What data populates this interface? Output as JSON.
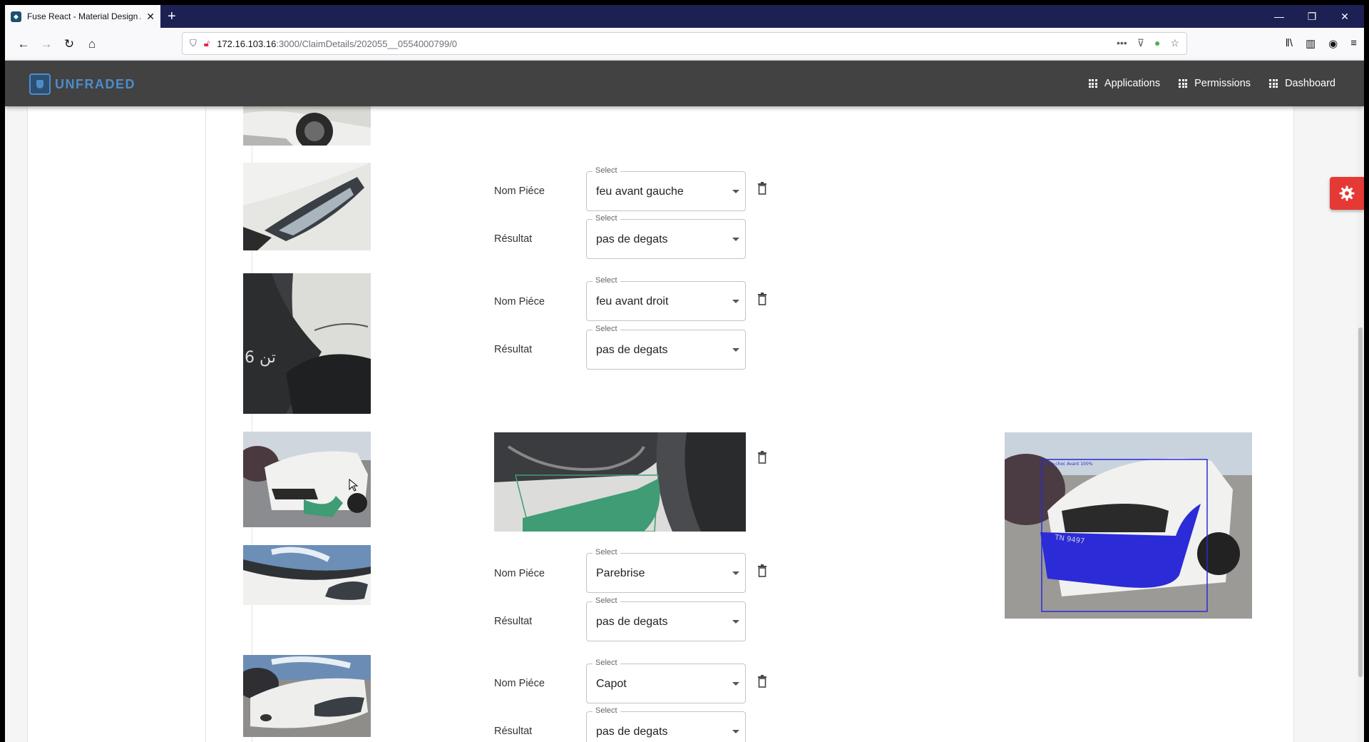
{
  "browser": {
    "tab_title": "Fuse React - Material Design A",
    "tab_close": "✕",
    "new_tab": "+",
    "url_host": "172.16.103.16",
    "url_path": ":3000/ClaimDetails/202055__0554000799/0",
    "url_more": "•••",
    "window_minimize": "—",
    "window_restore": "❐",
    "window_close": "✕"
  },
  "app": {
    "logo_text": "UNFRADED",
    "accent_color": "#4d8cc9",
    "header_bg": "#424242",
    "nav": [
      {
        "label": "Applications",
        "icon": "grid-icon"
      },
      {
        "label": "Permissions",
        "icon": "grid-icon"
      },
      {
        "label": "Dashboard",
        "icon": "grid-icon"
      }
    ]
  },
  "labels": {
    "part_name": "Nom Piéce",
    "result": "Résultat",
    "select_legend": "Select"
  },
  "parts": [
    {
      "part": "feu avant gauche",
      "result": "pas de degats"
    },
    {
      "part": "feu avant droit",
      "result": "pas de degats"
    },
    {
      "part": "Parebrise",
      "result": "pas de degats"
    },
    {
      "part": "Capot",
      "result": "pas de degats"
    }
  ],
  "detection": {
    "overlay_color": "#2b2bd8",
    "crop_mask_color": "#3f9c74",
    "box_label": "Pare-choc Avant 100%",
    "plate_text": "TN 9497"
  },
  "settings_fab_color": "#e53935"
}
